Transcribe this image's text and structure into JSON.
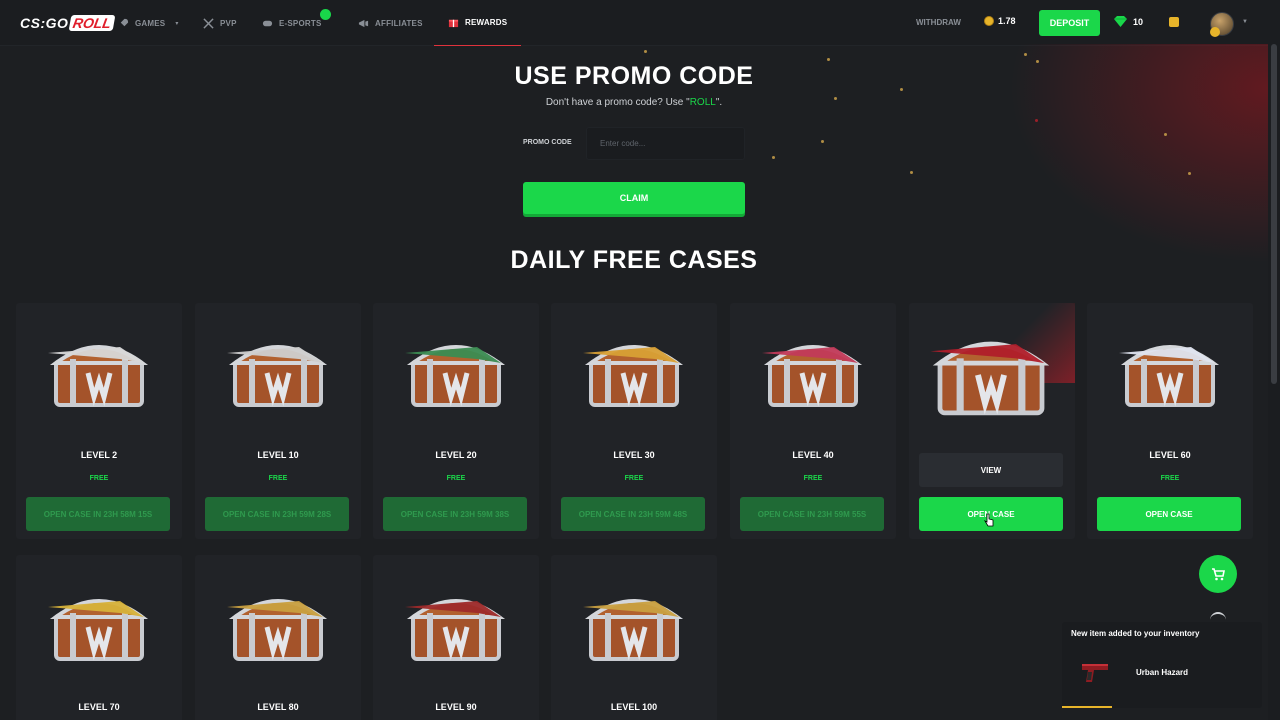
{
  "brand": {
    "logo_left": "CS:GO",
    "logo_right": "ROLL"
  },
  "nav": {
    "items": [
      {
        "label": "GAMES",
        "icon": "rocket-icon"
      },
      {
        "label": "PVP",
        "icon": "swords-icon"
      },
      {
        "label": "E-SPORTS",
        "icon": "gamepad-icon"
      },
      {
        "label": "AFFILIATES",
        "icon": "megaphone-icon"
      },
      {
        "label": "REWARDS",
        "icon": "gift-icon"
      }
    ],
    "withdraw": "WITHDRAW",
    "balance": "1.78",
    "deposit": "DEPOSIT",
    "gems": "10"
  },
  "promo": {
    "title": "USE PROMO CODE",
    "subtitle_prefix": "Don't have a promo code? Use \"",
    "subtitle_code": "ROLL",
    "subtitle_suffix": "\".",
    "label": "PROMO CODE",
    "placeholder": "Enter code...",
    "claim": "CLAIM"
  },
  "daily": {
    "title": "DAILY FREE CASES",
    "cases": [
      {
        "level": "LEVEL 2",
        "free": "FREE",
        "button": "OPEN CASE IN 23H 58M 15S",
        "enabled": false
      },
      {
        "level": "LEVEL 10",
        "free": "FREE",
        "button": "OPEN CASE IN 23H 59M 28S",
        "enabled": false
      },
      {
        "level": "LEVEL 20",
        "free": "FREE",
        "button": "OPEN CASE IN 23H 59M 38S",
        "enabled": false
      },
      {
        "level": "LEVEL 30",
        "free": "FREE",
        "button": "OPEN CASE IN 23H 59M 48S",
        "enabled": false
      },
      {
        "level": "LEVEL 40",
        "free": "FREE",
        "button": "OPEN CASE IN 23H 59M 55S",
        "enabled": false
      },
      {
        "level": "",
        "free": "",
        "view": "VIEW",
        "button": "OPEN CASE",
        "enabled": true
      },
      {
        "level": "LEVEL 60",
        "free": "FREE",
        "button": "OPEN CASE",
        "enabled": true
      }
    ],
    "row2": [
      {
        "level": "LEVEL 70"
      },
      {
        "level": "LEVEL 80"
      },
      {
        "level": "LEVEL 90"
      },
      {
        "level": "LEVEL 100"
      }
    ]
  },
  "toast": {
    "title": "New item added to your inventory",
    "item": "Urban Hazard",
    "progress": 0.25
  },
  "colors": {
    "accent_green": "#1bd74a",
    "accent_red": "#e0323c",
    "coin_gold": "#e7b42a"
  }
}
